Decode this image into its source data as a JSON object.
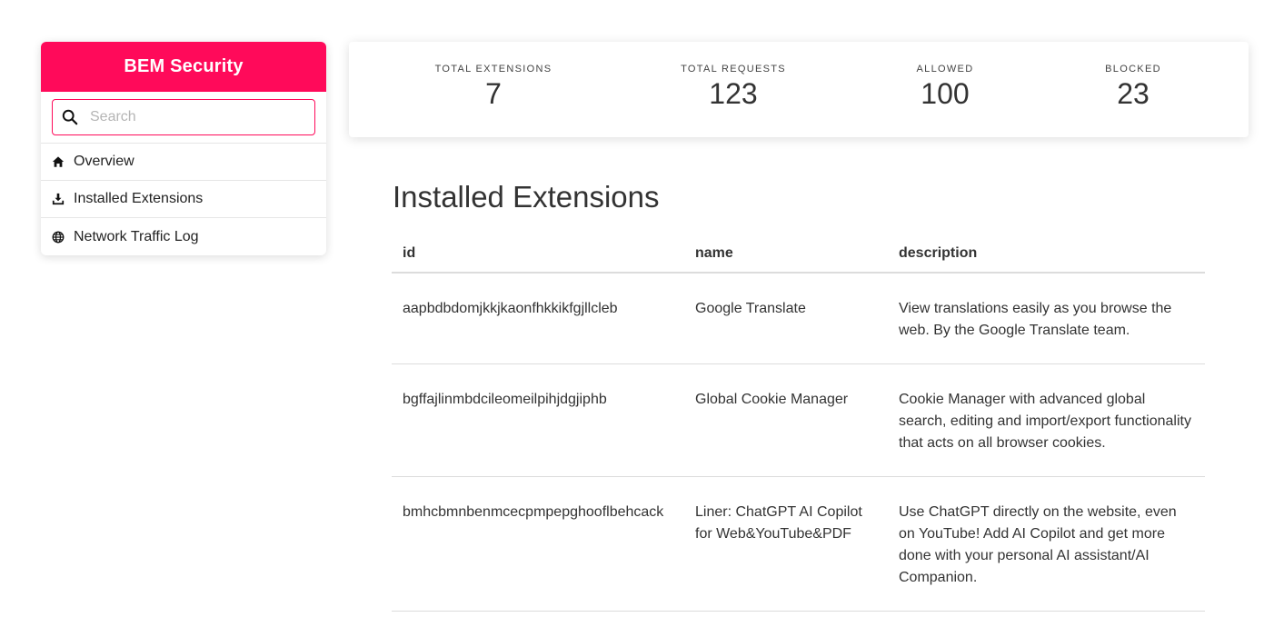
{
  "sidebar": {
    "brand": "BEM Security",
    "search_placeholder": "Search",
    "search_value": "",
    "items": [
      {
        "label": "Overview",
        "icon": "home-icon"
      },
      {
        "label": "Installed Extensions",
        "icon": "download-icon"
      },
      {
        "label": "Network Traffic Log",
        "icon": "globe-icon"
      }
    ]
  },
  "stats": [
    {
      "label": "TOTAL EXTENSIONS",
      "value": "7"
    },
    {
      "label": "TOTAL REQUESTS",
      "value": "123"
    },
    {
      "label": "ALLOWED",
      "value": "100"
    },
    {
      "label": "BLOCKED",
      "value": "23"
    }
  ],
  "main": {
    "title": "Installed Extensions",
    "columns": [
      "id",
      "name",
      "description"
    ],
    "rows": [
      {
        "id": "aapbdbdomjkkjkaonfhkkikfgjllcleb",
        "name": "Google Translate",
        "description": "View translations easily as you browse the web. By the Google Translate team."
      },
      {
        "id": "bgffajlinmbdcileomeilpihjdgjiphb",
        "name": "Global Cookie Manager",
        "description": "Cookie Manager with advanced global search, editing and import/export functionality that acts on all browser cookies."
      },
      {
        "id": "bmhcbmnbenmcecpmpepghooflbehcack",
        "name": "Liner: ChatGPT AI Copilot for Web&YouTube&PDF",
        "description": "Use ChatGPT directly on the website, even on YouTube! Add AI Copilot and get more done with your personal AI assistant/AI Companion."
      }
    ]
  },
  "colors": {
    "brand": "#ff0a5a",
    "text": "#333333",
    "divider": "#dcdcdc"
  }
}
